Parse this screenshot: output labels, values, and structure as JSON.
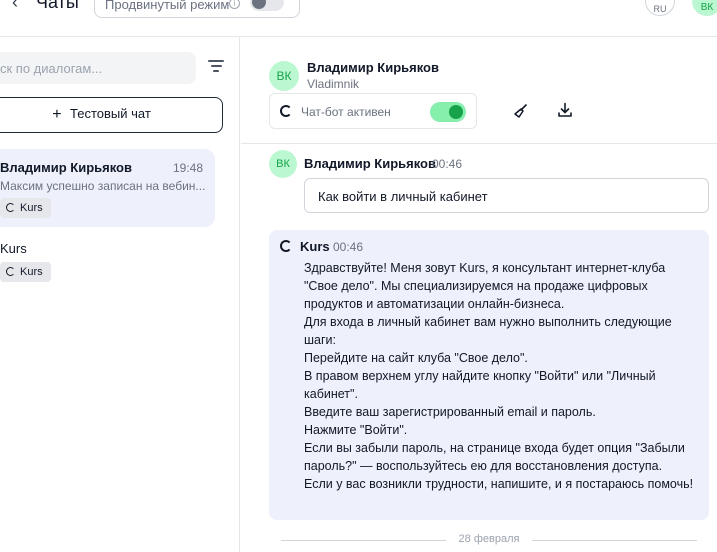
{
  "topbar": {
    "back_icon": "chevron-left-icon",
    "title": "Чаты",
    "advanced_mode_label": "Продвинутый режим",
    "advanced_mode_on": false,
    "language": "RU",
    "user_initials": "ВК"
  },
  "sidebar": {
    "search_placeholder": "ск по диалогам...",
    "new_chat_label": "Тестовый чат",
    "chats": [
      {
        "name": "Владимир Кирьяков",
        "time": "19:48",
        "preview": "Максим успешно записан на вебин...",
        "tag": "Kurs",
        "active": true
      },
      {
        "name": "Kurs",
        "time": "",
        "preview": "",
        "tag": "Kurs",
        "active": false
      }
    ]
  },
  "conversation": {
    "contact_initials": "ВК",
    "contact_name": "Владимир Кирьяков",
    "contact_username": "Vladimnik",
    "bot_status_label": "Чат-бот активен",
    "bot_active": true,
    "accent_color": "#16a34a",
    "messages": [
      {
        "author": "Владимир Кирьяков",
        "initials": "ВК",
        "time": "00:46",
        "text": "Как войти в личный кабинет"
      },
      {
        "author": "Kurs",
        "time": "00:46",
        "lines": [
          "Здравствуйте! Меня зовут Kurs, я консультант интернет-клуба \"Свое дело\". Мы специализируемся на продаже цифровых продуктов и автоматизации онлайн-бизнеса.",
          "Для входа в личный кабинет вам нужно выполнить следующие шаги:",
          "Перейдите на сайт клуба \"Свое дело\".",
          "В правом верхнем углу найдите кнопку \"Войти\" или \"Личный кабинет\".",
          "Введите ваш зарегистрированный email и пароль.",
          "Нажмите \"Войти\".",
          "Если вы забыли пароль, на странице входа будет опция \"Забыли пароль?\" — воспользуйтесь ею для восстановления доступа.",
          "Если у вас возникли трудности, напишите, и я постараюсь помочь!"
        ]
      }
    ],
    "date_separator": "28 февраля"
  }
}
